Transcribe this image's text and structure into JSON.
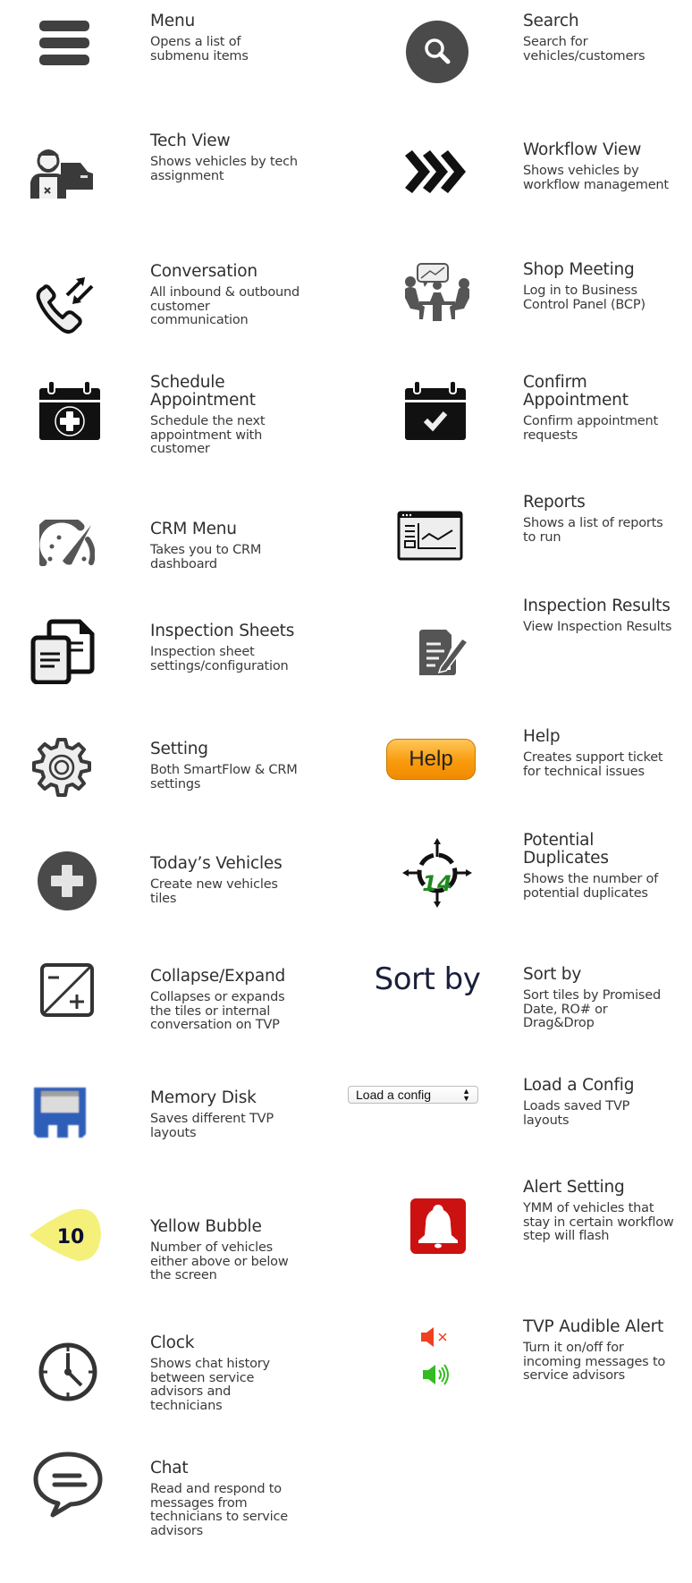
{
  "items": [
    {
      "title": "Menu",
      "desc": "Opens a list of submenu items",
      "icon": "hamburger-menu-icon"
    },
    {
      "title": "Search",
      "desc": "Search for vehicles/customers",
      "icon": "search-icon"
    },
    {
      "title": "Tech View",
      "desc": "Shows vehicles by tech assignment",
      "icon": "technician-car-icon"
    },
    {
      "title": "Workflow View",
      "desc": "Shows vehicles by workflow management",
      "icon": "triple-chevron-right-icon"
    },
    {
      "title": "Conversation",
      "desc": "All inbound & outbound customer communication",
      "icon": "phone-arrows-icon"
    },
    {
      "title": "Shop Meeting",
      "desc": "Log in to Business Control Panel (BCP)",
      "icon": "meeting-icon"
    },
    {
      "title": "Schedule Appointment",
      "desc": "Schedule the next appointment with customer",
      "icon": "calendar-plus-icon"
    },
    {
      "title": "Confirm Appointment",
      "desc": "Confirm appointment requests",
      "icon": "calendar-check-icon"
    },
    {
      "title": "CRM Menu",
      "desc": "Takes you to CRM dashboard",
      "icon": "dashboard-gauge-icon"
    },
    {
      "title": "Reports",
      "desc": "Shows a list of reports to run",
      "icon": "report-chart-icon"
    },
    {
      "title": "Inspection Sheets",
      "desc": "Inspection sheet settings/configuration",
      "icon": "documents-icon"
    },
    {
      "title": "Inspection Results",
      "desc": "View Inspection Results",
      "icon": "edit-document-icon"
    },
    {
      "title": "Setting",
      "desc": "Both SmartFlow & CRM settings",
      "icon": "gear-icon"
    },
    {
      "title": "Help",
      "desc": "Creates support ticket for technical issues",
      "icon": "help-button-icon",
      "icon_label": "Help"
    },
    {
      "title": "Today’s Vehicles",
      "desc": "Create new vehicles tiles",
      "icon": "plus-circle-icon"
    },
    {
      "title": "Potential Duplicates",
      "desc": "Shows the number of potential duplicates",
      "icon": "crosshair-count-icon",
      "icon_label": "14"
    },
    {
      "title": "Collapse/Expand",
      "desc": "Collapses or expands the tiles or internal conversation on TVP",
      "icon": "collapse-expand-icon"
    },
    {
      "title": "Sort by",
      "desc": "Sort tiles by Promised Date, RO# or Drag&Drop",
      "icon": "sort-by-text-icon",
      "icon_label": "Sort by"
    },
    {
      "title": "Memory Disk",
      "desc": "Saves different TVP layouts",
      "icon": "floppy-disk-icon"
    },
    {
      "title": "Load a Config",
      "desc": "Loads saved TVP layouts",
      "icon": "config-select",
      "icon_label": "Load a config"
    },
    {
      "title": "Yellow Bubble",
      "desc": "Number of vehicles either above or below the screen",
      "icon": "yellow-bubble-icon",
      "icon_label": "10"
    },
    {
      "title": "Alert Setting",
      "desc": "YMM of vehicles that stay in certain workflow step will flash",
      "icon": "bell-alert-icon"
    },
    {
      "title": "Clock",
      "desc": "Shows chat history between service advisors and technicians",
      "icon": "clock-icon"
    },
    {
      "title": "TVP Audible Alert",
      "desc": "Turn it on/off for incoming messages to service advisors",
      "icon": "speaker-mute-unmute-icon"
    },
    {
      "title": "Chat",
      "desc": "Read and respond to messages from technicians to service advisors",
      "icon": "chat-bubble-icon"
    }
  ],
  "colors": {
    "icon_dark": "#404040",
    "icon_black": "#111111",
    "help_orange": "#f99b0c",
    "bubble_yellow": "#f5f07a",
    "alert_red": "#cc1111",
    "mute_red": "#f04020",
    "sound_green": "#33bb22",
    "duplicate_green": "#1e8a1e",
    "floppy_blue": "#2f5fb8"
  }
}
